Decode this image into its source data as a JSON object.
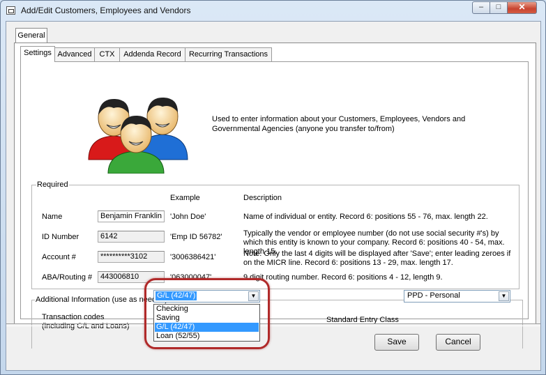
{
  "window": {
    "title": "Add/Edit Customers, Employees and Vendors",
    "min": "–",
    "max": "□",
    "close": "✕"
  },
  "tabs": {
    "general": "General",
    "sub": [
      "Settings",
      "Advanced",
      "CTX",
      "Addenda Record",
      "Recurring Transactions"
    ]
  },
  "intro": "Used to enter information about your Customers, Employees, Vendors and Governmental Agencies (anyone you transfer to/from)",
  "required": {
    "legend": "Required",
    "example_header": "Example",
    "description_header": "Description",
    "rows": [
      {
        "label": "Name",
        "value": "Benjamin Franklin",
        "example": "'John Doe'",
        "description": "Name of individual or entity. Record 6: positions 55 - 76, max. length 22."
      },
      {
        "label": "ID Number",
        "value": "6142",
        "example": "'Emp ID 56782'",
        "description": "Typically the vendor or employee number (do not use social security #'s) by which this entity is known to your company. Record 6: positions 40 - 54, max. length 15."
      },
      {
        "label": "Account #",
        "value": "**********3102",
        "example": "'3006386421'",
        "description": "Note: Only the last 4 digits will be displayed after 'Save'; enter leading zeroes if on the MICR line. Record 6: positions 13 - 29, max. length 17."
      },
      {
        "label": "ABA/Routing #",
        "value": "443006810",
        "example": "'063000047'",
        "description": "9 digit routing number. Record 6: positions 4 - 12, length 9."
      }
    ]
  },
  "additional": {
    "legend": "Additional Information (use as needed)",
    "transaction_codes_label": "Transaction codes\n(including G/L and Loans)",
    "transaction_codes_value": "G/L (42/47)",
    "transaction_codes_options": [
      "Checking",
      "Saving",
      "G/L (42/47)",
      "Loan (52/55)"
    ],
    "sec_label": "Standard Entry Class",
    "sec_value": "PPD - Personal"
  },
  "buttons": {
    "save": "Save",
    "cancel": "Cancel"
  },
  "colors": {
    "selection": "#3399ff",
    "highlight": "#b02a2a"
  },
  "icons": {
    "people": "users-icon"
  }
}
